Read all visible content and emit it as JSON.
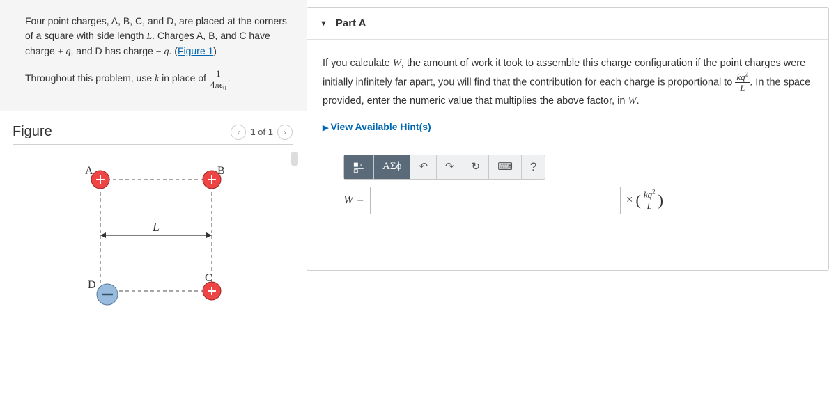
{
  "problem": {
    "p1_a": "Four point charges, A, B, C, and D, are placed at the corners of a square with side length ",
    "p1_L": "L",
    "p1_b": ". Charges A, B, and C have charge ",
    "p1_plus": "+",
    "p1_q1": "q",
    "p1_c": ", and D has charge ",
    "p1_minus": "−",
    "p1_q2": "q",
    "p1_d": ". (",
    "p1_link": "Figure 1",
    "p1_e": ")",
    "p2_a": "Throughout this problem, use ",
    "p2_k": "k",
    "p2_b": " in place of ",
    "frac_num": "1",
    "frac_den_a": "4π",
    "frac_den_eps": "ϵ",
    "frac_den_zero": "0",
    "p2_c": "."
  },
  "figure": {
    "title": "Figure",
    "pager": "1 of 1",
    "labels": {
      "A": "A",
      "B": "B",
      "C": "C",
      "D": "D",
      "L": "L"
    }
  },
  "part": {
    "title": "Part A",
    "q_a": "If you calculate ",
    "W1": "W",
    "q_b": ", the amount of work it took to assemble this charge configuration if the point charges were initially infinitely far apart, you will find that the contribution for each charge is proportional to ",
    "frac2_num_a": "kq",
    "frac2_num_sup": "2",
    "frac2_den": "L",
    "q_c": ". In the space provided, enter the numeric value that multiplies the above factor, in ",
    "W2": "W",
    "q_d": ".",
    "hint": "View Available Hint(s)",
    "toolbar": {
      "templates_alt": "templates",
      "greek": "ΑΣϕ",
      "undo": "↶",
      "redo": "↷",
      "reset": "↻",
      "keyboard": "⌨",
      "help": "?"
    },
    "answer": {
      "label_W": "W",
      "label_eq": " = ",
      "value": "",
      "times": "×",
      "suf_num_a": "kq",
      "suf_num_sup": "2",
      "suf_den": "L"
    }
  }
}
